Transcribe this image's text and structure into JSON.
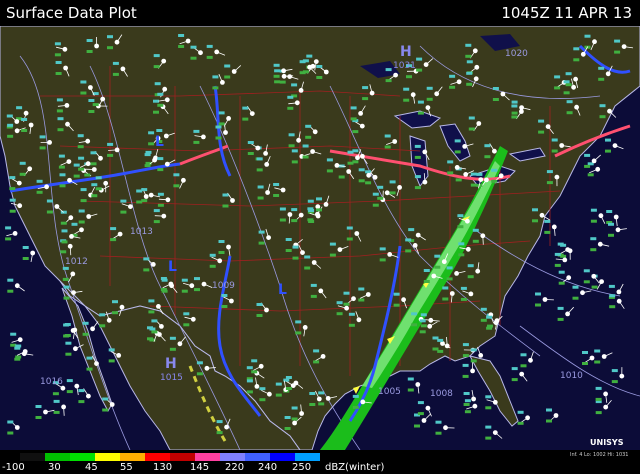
{
  "header": {
    "title": "Surface Data Plot",
    "timestamp": "1045Z  11 APR 13"
  },
  "legend": {
    "colors": [
      "#101010",
      "#00c000",
      "#00e000",
      "#ffff00",
      "#ffb000",
      "#ff0000",
      "#c00000",
      "#ff40a0",
      "#8080ff",
      "#4060ff",
      "#0000ff",
      "#00a0ff"
    ],
    "labels": [
      "-100",
      "30",
      "45",
      "55",
      "130",
      "145",
      "220",
      "240",
      "250"
    ],
    "unit": "dBZ(winter)"
  },
  "brand": {
    "name": "UNISYS",
    "sub": "Inf. 4 Lo: 1002 Hi: 1031"
  },
  "pressure_labels": [
    {
      "id": "high-ne",
      "text": "H"
    },
    {
      "id": "high-ne-val",
      "text": "1031"
    },
    {
      "id": "low-west",
      "text": "L"
    },
    {
      "id": "low-sw",
      "text": "L"
    },
    {
      "id": "low-plains",
      "text": "L"
    },
    {
      "id": "high-mex",
      "text": "H"
    },
    {
      "id": "high-mex-val",
      "text": "1015"
    },
    {
      "id": "val-1016",
      "text": "1016"
    },
    {
      "id": "val-1012",
      "text": "1012"
    },
    {
      "id": "val-1009",
      "text": "1009"
    },
    {
      "id": "val-1005",
      "text": "1005"
    },
    {
      "id": "val-1008",
      "text": "1008"
    },
    {
      "id": "val-1013",
      "text": "1013"
    },
    {
      "id": "val-1020",
      "text": "1020"
    },
    {
      "id": "val-1010",
      "text": "1010"
    }
  ]
}
